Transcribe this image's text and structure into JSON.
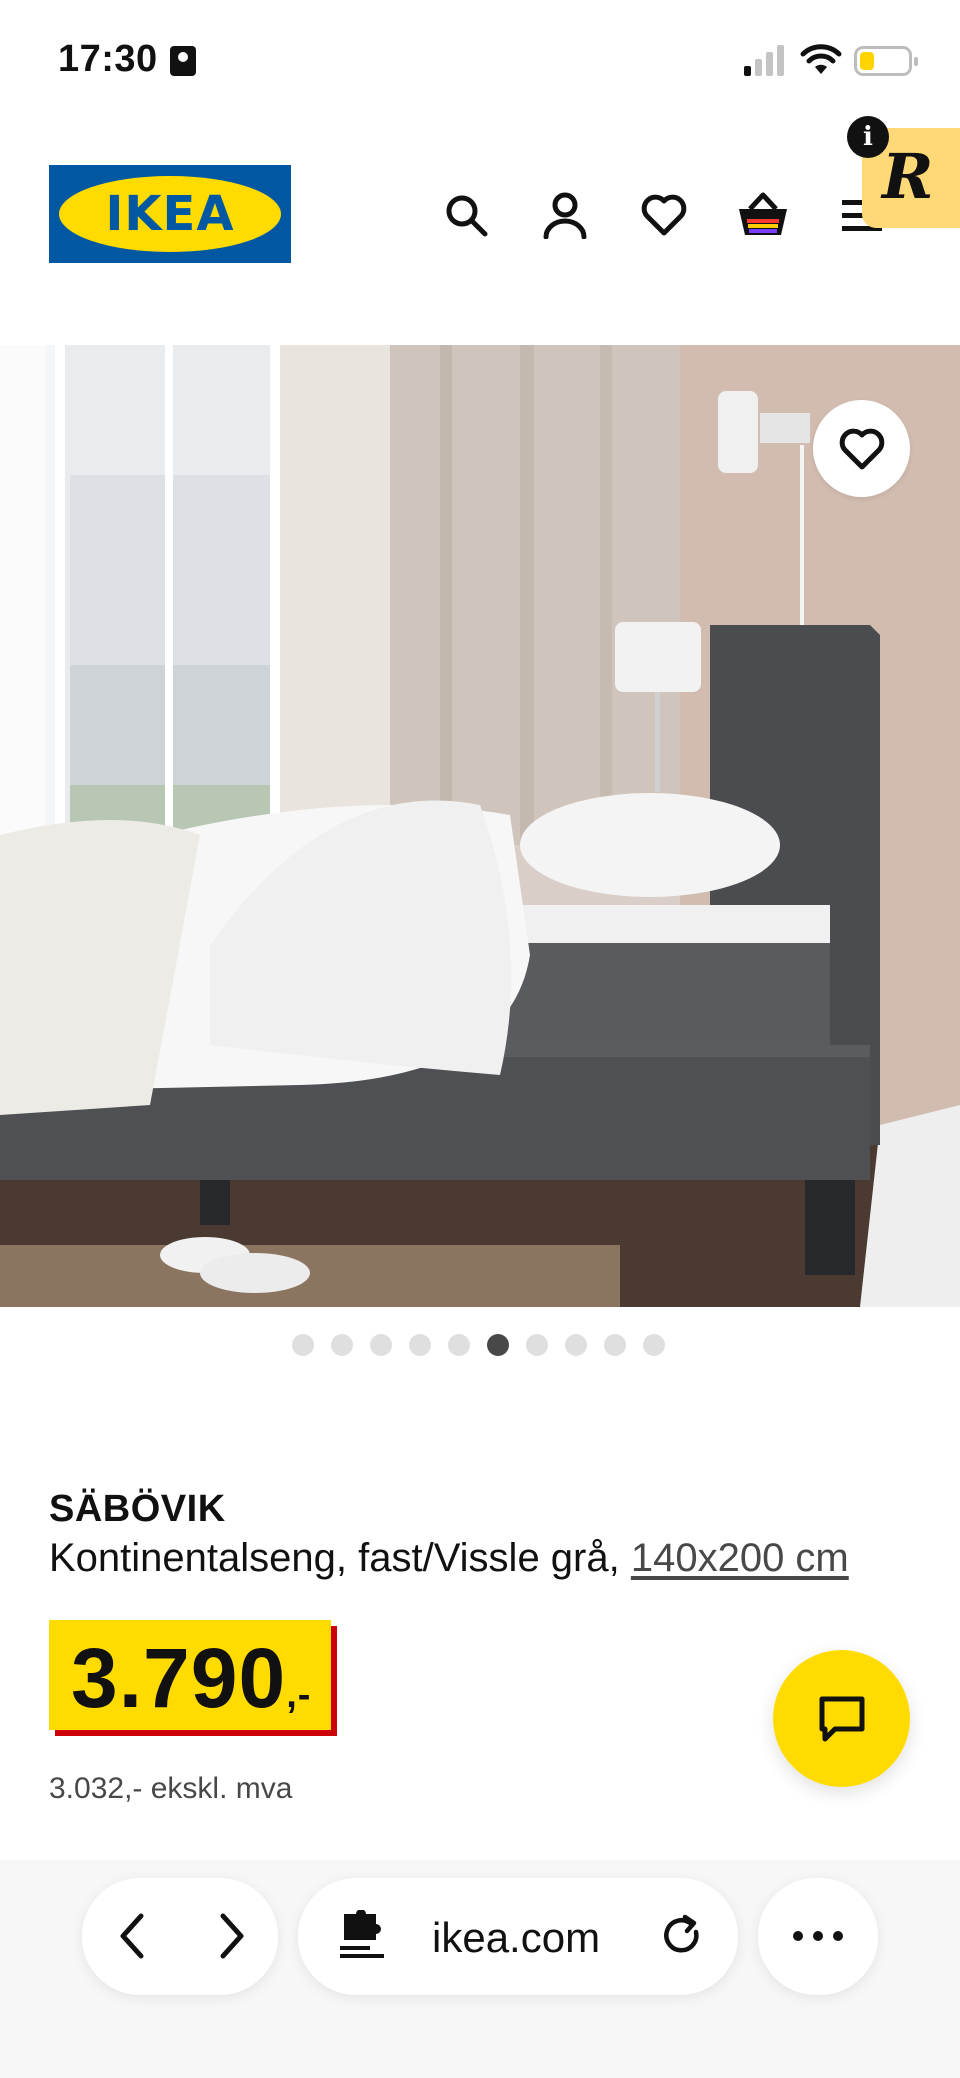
{
  "status_bar": {
    "time": "17:30",
    "battery_level": 0.3
  },
  "header": {
    "logo_text": "IKEA",
    "icons": [
      "search-icon",
      "account-icon",
      "heart-icon",
      "cart-icon",
      "menu-icon"
    ],
    "extension_badge": "R",
    "extension_info": "i"
  },
  "gallery": {
    "dot_count": 10,
    "active_index": 5
  },
  "product": {
    "name": "SÄBÖVIK",
    "description": "Kontinentalseng, fast/Vissle grå, ",
    "size": "140x200 cm",
    "price": "3.790",
    "price_suffix": ",-",
    "price_ex_vat": "3.032,- ekskl. mva"
  },
  "browser": {
    "url": "ikea.com"
  },
  "colors": {
    "ikea_blue": "#0058a3",
    "ikea_yellow": "#ffdb00",
    "price_shadow": "#cc0008"
  }
}
